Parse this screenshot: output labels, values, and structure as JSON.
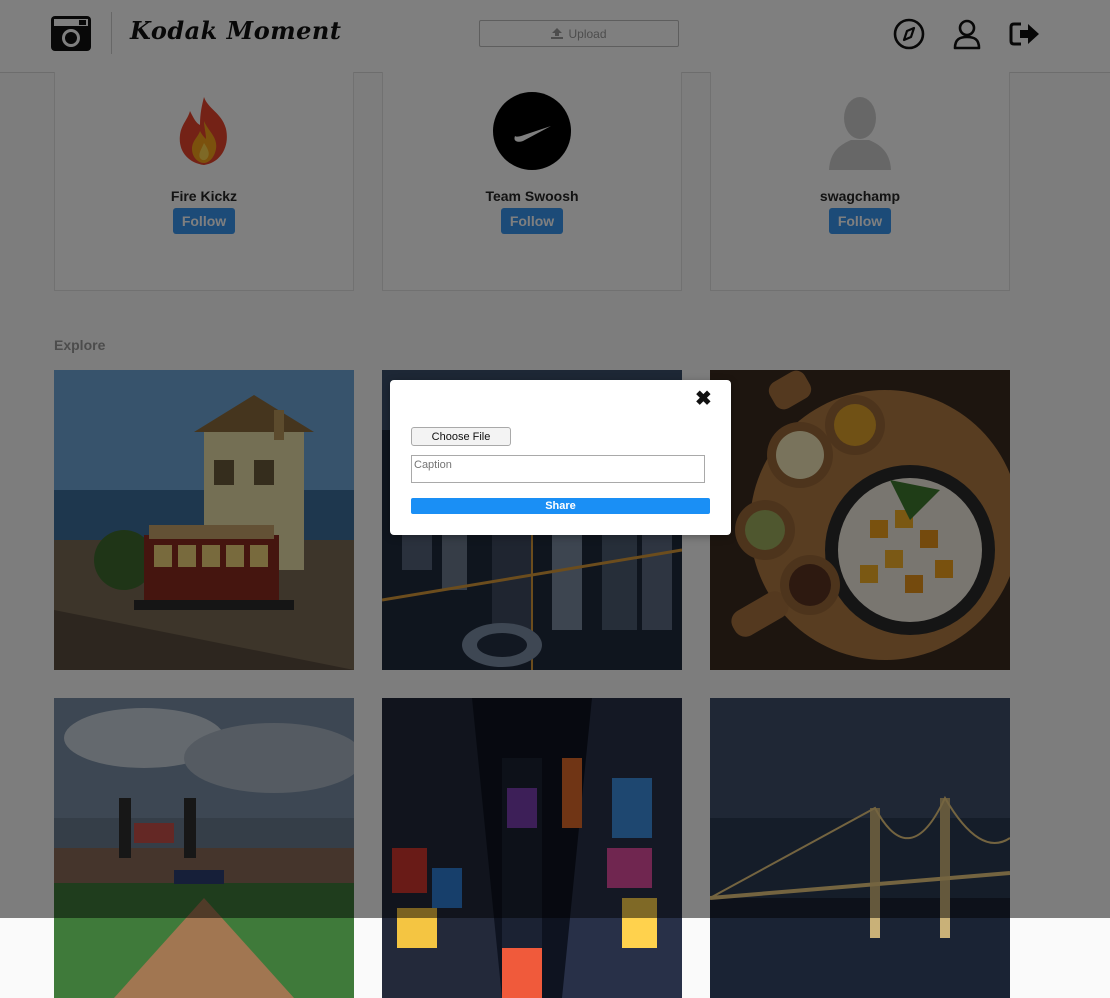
{
  "header": {
    "brand": "Kodak Moment",
    "upload_label": "Upload",
    "icons": [
      "camera-logo-icon",
      "compass-icon",
      "user-icon",
      "logout-icon"
    ]
  },
  "suggestions": [
    {
      "name": "Fire Kickz",
      "follow_label": "Follow",
      "avatar": "fire-emoji"
    },
    {
      "name": "Team Swoosh",
      "follow_label": "Follow",
      "avatar": "swoosh-logo"
    },
    {
      "name": "swagchamp",
      "follow_label": "Follow",
      "avatar": "default-avatar"
    }
  ],
  "explore": {
    "title": "Explore",
    "tiles": [
      "cable-car-photo",
      "city-aerial-photo",
      "mango-dessert-photo",
      "ballpark-photo",
      "times-square-photo",
      "bay-bridge-photo"
    ]
  },
  "modal": {
    "close_symbol": "✖",
    "choose_file_label": "Choose File",
    "caption_placeholder": "Caption",
    "share_label": "Share"
  },
  "colors": {
    "accent": "#3897f0",
    "share": "#1a8ff5",
    "overlay": "rgba(0,0,0,0.5)"
  }
}
